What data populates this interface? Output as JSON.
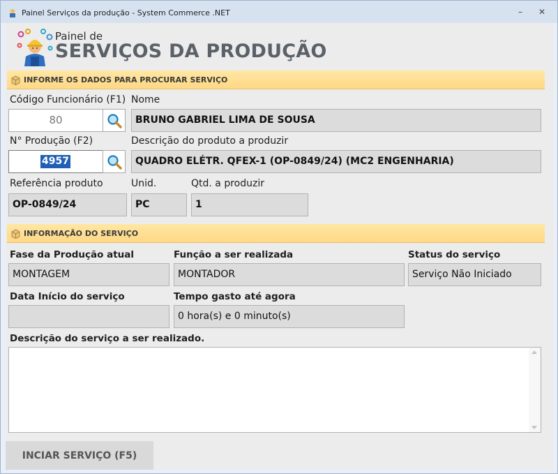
{
  "window": {
    "title": "Painel Serviços da produção  -  System Commerce .NET",
    "minimize_glyph": "–",
    "close_glyph": "✕"
  },
  "header": {
    "subtitle": "Painel de",
    "title": "SERVIÇOS DA PRODUÇÃO"
  },
  "search_section": {
    "title": "INFORME OS DADOS PARA PROCURAR SERVIÇO",
    "employee_code_label": "Código Funcionário (F1)",
    "employee_code_value": "80",
    "name_label": "Nome",
    "name_value": "BRUNO GABRIEL LIMA DE SOUSA",
    "production_label": "N° Produção (F2)",
    "production_value": "4957",
    "product_desc_label": "Descrição do produto a produzir",
    "product_desc_value": "QUADRO ELÉTR. QFEX-1 (OP-0849/24) (MC2 ENGENHARIA)",
    "ref_label": "Referência produto",
    "ref_value": "OP-0849/24",
    "unit_label": "Unid.",
    "unit_value": "PC",
    "qty_label": "Qtd. a produzir",
    "qty_value": "1"
  },
  "info_section": {
    "title": "INFORMAÇÃO DO SERVIÇO",
    "phase_label": "Fase da Produção atual",
    "phase_value": "MONTAGEM",
    "function_label": "Função a ser realizada",
    "function_value": "MONTADOR",
    "status_label": "Status do serviço",
    "status_value": "Serviço Não Iniciado",
    "start_date_label": "Data Início do serviço",
    "start_date_value": "",
    "elapsed_label": "Tempo gasto até agora",
    "elapsed_value": "0 hora(s) e 0 minuto(s)",
    "description_label": "Descrição do serviço a ser realizado.",
    "description_value": ""
  },
  "footer": {
    "start_button": "INCIAR SERVIÇO (F5)"
  },
  "colors": {
    "section_bar": "#ffd886",
    "selection": "#1f5fb5",
    "field_bg": "#dcdcdc"
  },
  "icons": {
    "app": "worker-icon",
    "logo": "worker-gears-icon",
    "section": "box-icon",
    "search": "magnifier-icon"
  }
}
